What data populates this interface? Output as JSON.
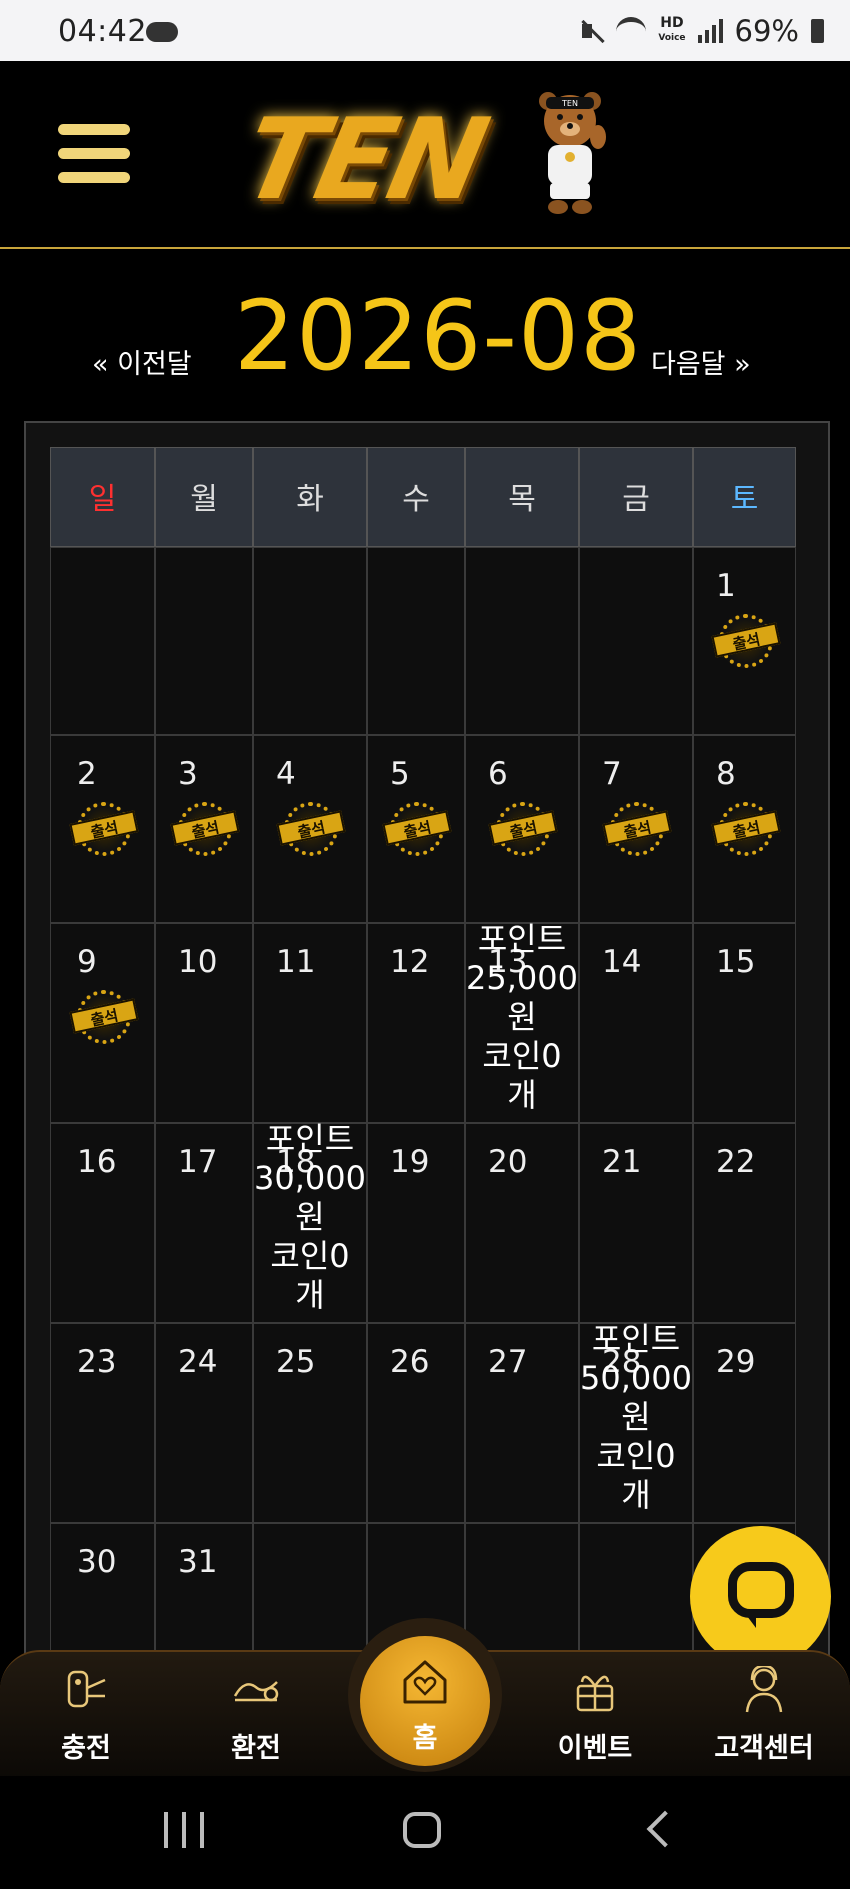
{
  "status_bar": {
    "time": "04:42",
    "hd": "HD",
    "voice": "Voice",
    "battery": "69%"
  },
  "header": {
    "logo_text": "TEN",
    "mascot_badge": "TEN"
  },
  "month_nav": {
    "prev_label": "« 이전달",
    "title": "2026-08",
    "next_label": "다음달 »"
  },
  "calendar": {
    "weekdays": [
      "일",
      "월",
      "화",
      "수",
      "목",
      "금",
      "토"
    ],
    "weekday_colors": [
      "#ff3030",
      "#dddddd",
      "#dddddd",
      "#dddddd",
      "#dddddd",
      "#dddddd",
      "#5cb8ff"
    ],
    "stamp_label": "출석",
    "weeks": [
      [
        null,
        null,
        null,
        null,
        null,
        null,
        {
          "day": "1",
          "stamp": true
        }
      ],
      [
        {
          "day": "2",
          "stamp": true
        },
        {
          "day": "3",
          "stamp": true
        },
        {
          "day": "4",
          "stamp": true
        },
        {
          "day": "5",
          "stamp": true
        },
        {
          "day": "6",
          "stamp": true
        },
        {
          "day": "7",
          "stamp": true
        },
        {
          "day": "8",
          "stamp": true
        }
      ],
      [
        {
          "day": "9",
          "stamp": true
        },
        {
          "day": "10"
        },
        {
          "day": "11"
        },
        {
          "day": "12"
        },
        {
          "day": "13",
          "reward": [
            "포인트",
            "25,000",
            "원",
            "코인0",
            "개"
          ]
        },
        {
          "day": "14"
        },
        {
          "day": "15"
        }
      ],
      [
        {
          "day": "16"
        },
        {
          "day": "17"
        },
        {
          "day": "18",
          "reward": [
            "포인트",
            "30,000",
            "원",
            "코인0",
            "개"
          ]
        },
        {
          "day": "19"
        },
        {
          "day": "20"
        },
        {
          "day": "21"
        },
        {
          "day": "22"
        }
      ],
      [
        {
          "day": "23"
        },
        {
          "day": "24"
        },
        {
          "day": "25"
        },
        {
          "day": "26"
        },
        {
          "day": "27"
        },
        {
          "day": "28",
          "reward": [
            "포인트",
            "50,000",
            "원",
            "코인0",
            "개"
          ]
        },
        {
          "day": "29"
        }
      ],
      [
        {
          "day": "30"
        },
        {
          "day": "31"
        },
        null,
        null,
        null,
        null,
        null
      ]
    ]
  },
  "bottom_nav": {
    "items": [
      {
        "label": "충전",
        "icon": "deposit-icon"
      },
      {
        "label": "환전",
        "icon": "exchange-icon"
      },
      {
        "label": "홈",
        "icon": "home-heart-icon"
      },
      {
        "label": "이벤트",
        "icon": "gift-icon"
      },
      {
        "label": "고객센터",
        "icon": "support-icon"
      }
    ]
  },
  "colors": {
    "accent": "#f5c518",
    "chat": "#f7ca1b",
    "home": "#e39a1e"
  }
}
